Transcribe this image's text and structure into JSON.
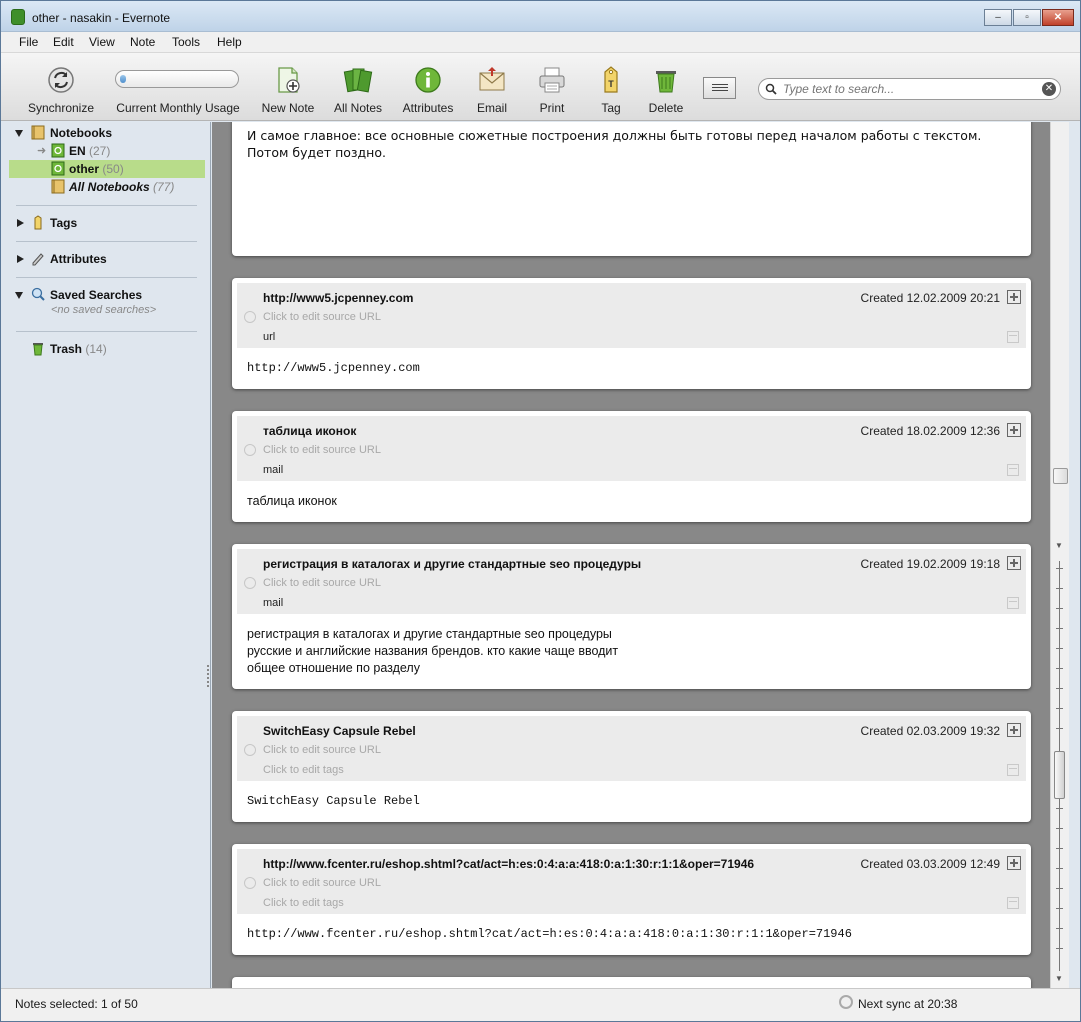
{
  "window": {
    "title": "other - nasakin - Evernote",
    "controls": {
      "minimize": "–",
      "maximize": "▫",
      "close": "✕"
    }
  },
  "menu": [
    "File",
    "Edit",
    "View",
    "Note",
    "Tools",
    "Help"
  ],
  "toolbar": {
    "synchronize": "Synchronize",
    "usage": "Current Monthly Usage",
    "usage_level": 0.03,
    "new_note": "New Note",
    "all_notes": "All Notes",
    "attributes": "Attributes",
    "email": "Email",
    "print": "Print",
    "tag": "Tag",
    "delete": "Delete",
    "search_placeholder": "Type text to search..."
  },
  "sidebar": {
    "notebooks": "Notebooks",
    "notebook_items": [
      {
        "name": "EN",
        "count": "(27)"
      },
      {
        "name": "other",
        "count": "(50)"
      },
      {
        "name": "All Notebooks",
        "count": "(77)"
      }
    ],
    "tags": "Tags",
    "attributes": "Attributes",
    "saved_searches": "Saved Searches",
    "no_saved": "<no saved searches>",
    "trash": "Trash",
    "trash_count": "(14)"
  },
  "notes_top": {
    "body": "И самое главное: все основные сюжетные построения должны быть готовы перед началом работы с текстом. Потом будет поздно."
  },
  "notes": [
    {
      "title": "http://www5.jcpenney.com",
      "created": "Created 12.02.2009 20:21",
      "source": "Click to edit source URL",
      "tags": "url",
      "body": "http://www5.jcpenney.com"
    },
    {
      "title": "таблица иконок",
      "created": "Created 18.02.2009 12:36",
      "source": "Click to edit source URL",
      "tags": "mail",
      "body": "таблица иконок"
    },
    {
      "title": "регистрация в каталогах и другие стандартные seo процедуры",
      "created": "Created 19.02.2009 19:18",
      "source": "Click to edit source URL",
      "tags": "mail",
      "body": "регистрация в каталогах и другие стандартные seo процедуры\nрусские и английские названия брендов. кто какие чаще вводит\nобщее отношение по разделу"
    },
    {
      "title": "SwitchEasy Capsule Rebel",
      "created": "Created 02.03.2009 19:32",
      "source": "Click to edit source URL",
      "tags": "Click to edit tags",
      "body": "SwitchEasy Capsule Rebel"
    },
    {
      "title": "http://www.fcenter.ru/eshop.shtml?cat/act=h:es:0:4:a:a:418:0:a:1:30:r:1:1&oper=71946",
      "created": "Created 03.03.2009 12:49",
      "source": "Click to edit source URL",
      "tags": "Click to edit tags",
      "body": "http://www.fcenter.ru/eshop.shtml?cat/act=h:es:0:4:a:a:418:0:a:1:30:r:1:1&oper=71946"
    }
  ],
  "status": {
    "selected": "Notes selected: 1 of 50",
    "next_sync": "Next sync at 20:38"
  }
}
